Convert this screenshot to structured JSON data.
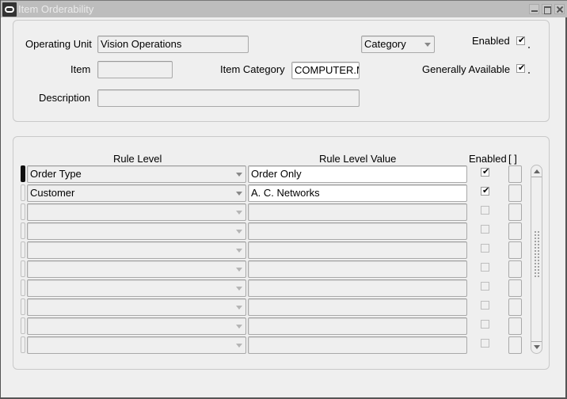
{
  "window": {
    "title": "Item Orderability",
    "icon": "oracle-icon",
    "buttons": [
      "minimize",
      "maximize",
      "close"
    ]
  },
  "header": {
    "operating_unit_label": "Operating Unit",
    "operating_unit_value": "Vision Operations",
    "criteria_select_value": "Category",
    "enabled_label": "Enabled",
    "enabled_checked": true,
    "item_label": "Item",
    "item_value": "",
    "item_category_label": "Item Category",
    "item_category_value": "COMPUTER.M",
    "generally_available_label": "Generally Available",
    "generally_available_checked": true,
    "description_label": "Description",
    "description_value": ""
  },
  "rules": {
    "columns": {
      "rule_level": "Rule Level",
      "rule_level_value": "Rule Level Value",
      "enabled": "Enabled",
      "folder": "[ ]"
    },
    "rows": [
      {
        "rule_level": "Order Type",
        "rule_level_value": "Order Only",
        "enabled": true,
        "current": true
      },
      {
        "rule_level": "Customer",
        "rule_level_value": "A. C. Networks",
        "enabled": true,
        "current": false
      },
      {
        "rule_level": "",
        "rule_level_value": "",
        "enabled": false,
        "current": false
      },
      {
        "rule_level": "",
        "rule_level_value": "",
        "enabled": false,
        "current": false
      },
      {
        "rule_level": "",
        "rule_level_value": "",
        "enabled": false,
        "current": false
      },
      {
        "rule_level": "",
        "rule_level_value": "",
        "enabled": false,
        "current": false
      },
      {
        "rule_level": "",
        "rule_level_value": "",
        "enabled": false,
        "current": false
      },
      {
        "rule_level": "",
        "rule_level_value": "",
        "enabled": false,
        "current": false
      },
      {
        "rule_level": "",
        "rule_level_value": "",
        "enabled": false,
        "current": false
      },
      {
        "rule_level": "",
        "rule_level_value": "",
        "enabled": false,
        "current": false
      }
    ]
  }
}
